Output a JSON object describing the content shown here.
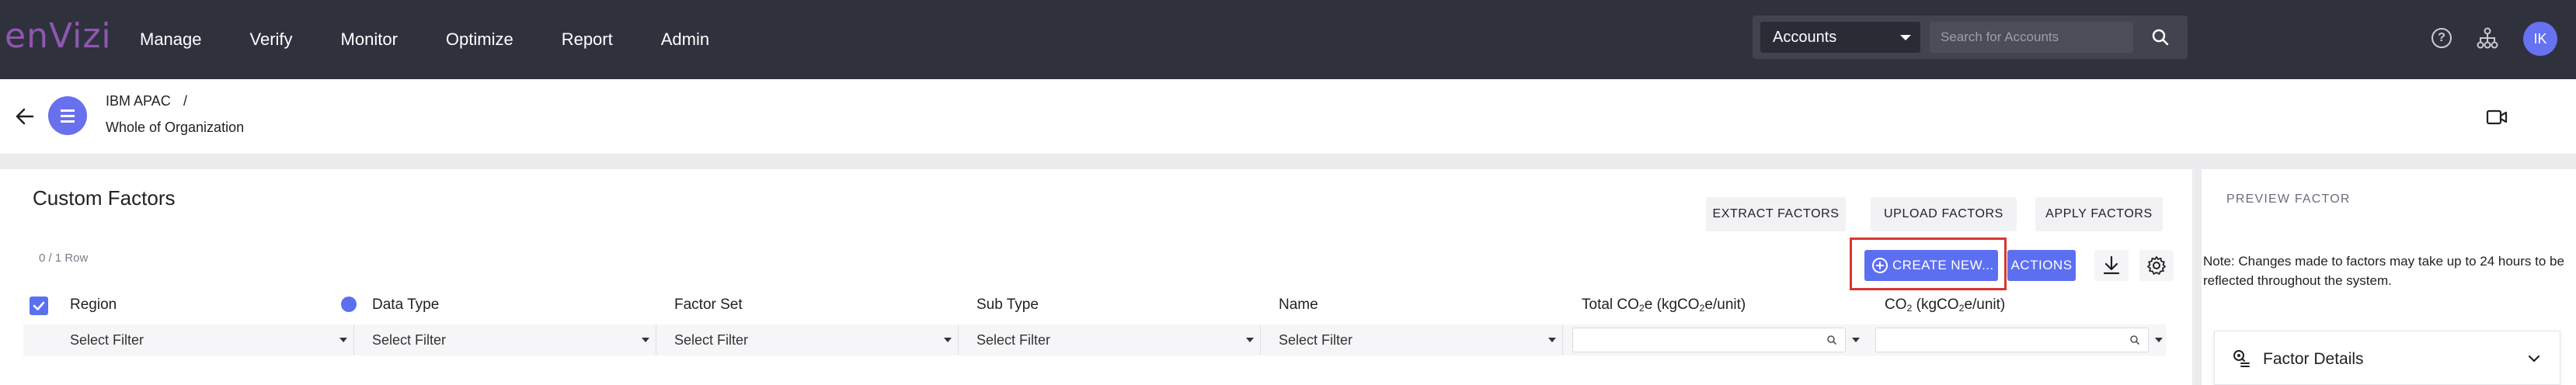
{
  "app": {
    "logo": "enVizi"
  },
  "nav": {
    "items": [
      "Manage",
      "Verify",
      "Monitor",
      "Optimize",
      "Report",
      "Admin"
    ]
  },
  "search": {
    "scope": "Accounts",
    "placeholder": "Search for Accounts"
  },
  "user": {
    "initials": "IK"
  },
  "breadcrumb": {
    "parent": "IBM APAC",
    "separator": "/",
    "current": "Whole of Organization"
  },
  "panel": {
    "title": "Custom Factors",
    "row_count": "0 / 1 Row",
    "buttons": {
      "extract": "EXTRACT FACTORS",
      "upload": "UPLOAD FACTORS",
      "apply": "APPLY FACTORS",
      "create": "CREATE NEW...",
      "actions": "ACTIONS"
    }
  },
  "table": {
    "columns": {
      "region": "Region",
      "data_type": "Data Type",
      "factor_set": "Factor Set",
      "sub_type": "Sub Type",
      "name": "Name",
      "total_co2e_a": "Total CO",
      "total_co2e_sub1": "2",
      "total_co2e_b": "e (kgCO",
      "total_co2e_sub2": "2",
      "total_co2e_c": "e/unit)",
      "co2_a": "CO",
      "co2_sub1": "2",
      "co2_b": " (kgCO",
      "co2_sub2": "2",
      "co2_c": "e/unit)"
    },
    "filter_placeholder": "Select Filter"
  },
  "preview": {
    "title": "PREVIEW FACTOR",
    "note": "Note: Changes made to factors may take up to 24 hours to be reflected throughout the system.",
    "section": "Factor Details"
  },
  "colors": {
    "accent": "#5c6ff0",
    "topbar": "#2f323d",
    "logo": "#8e57b0",
    "highlight": "#d9362f"
  }
}
